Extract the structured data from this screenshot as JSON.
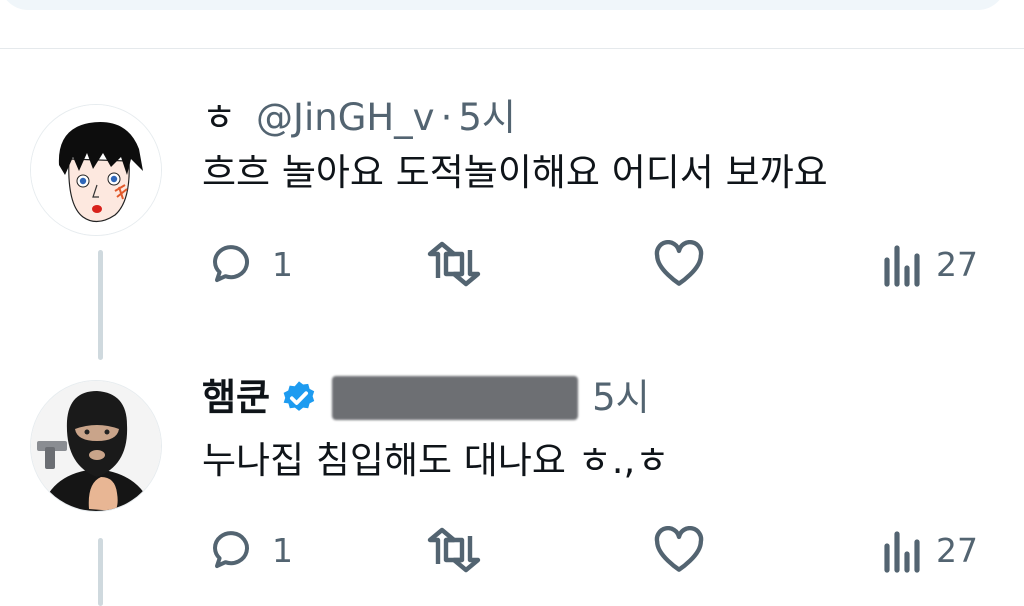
{
  "tweets": [
    {
      "name": "ㅎ",
      "handle": "@JinGH_v",
      "separator": "·",
      "time": "5시",
      "text": "흐흐 놀아요 도적놀이해요 어디서 보까요",
      "avatar": "cartoon-face-avatar",
      "actions": {
        "reply_count": "1",
        "retweet_count": "",
        "like_count": "",
        "views_count": "27"
      }
    },
    {
      "name": "햄쿤",
      "verified": true,
      "handle_redacted": true,
      "time": "5시",
      "text": "누나집 침입해도 대나요 ㅎ.,ㅎ",
      "avatar": "masked-person-avatar",
      "actions": {
        "reply_count": "1",
        "retweet_count": "",
        "like_count": "",
        "views_count": "27"
      }
    }
  ],
  "icons": {
    "reply": "reply-icon",
    "retweet": "retweet-icon",
    "like": "heart-icon",
    "views": "views-icon",
    "verified": "verified-badge-icon"
  },
  "colors": {
    "muted_text": "#536471",
    "verified_blue": "#1d9bf0",
    "thread_line": "#cfd9de",
    "divider": "#e5e9ec"
  }
}
